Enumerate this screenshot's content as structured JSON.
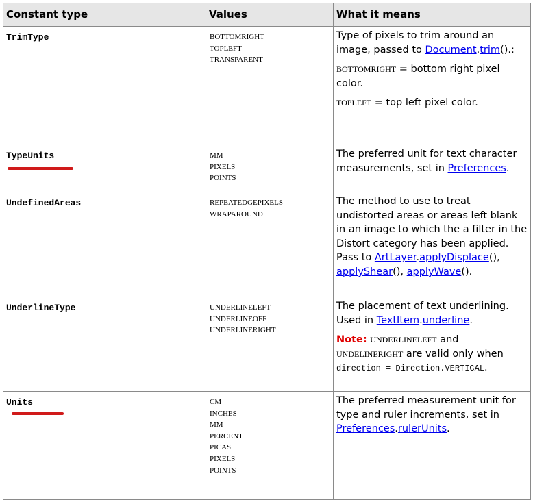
{
  "headers": [
    "Constant type",
    "Values",
    "What it means"
  ],
  "rows": [
    {
      "name": "TrimType",
      "values": [
        "BOTTOMRIGHT",
        "TOPLEFT",
        "TRANSPARENT"
      ],
      "desc": {
        "p1_text": "Type of pixels to trim around an image, passed to ",
        "p1_link1": "Document",
        "p1_dot": ".",
        "p1_link2": "trim",
        "p1_end": "().:",
        "p2_code": "BOTTOMRIGHT",
        "p2_text": " = bottom right pixel color.",
        "p3_code": "TOPLEFT",
        "p3_text": " = top left pixel color."
      }
    },
    {
      "name": "TypeUnits",
      "values": [
        "MM",
        "PIXELS",
        "POINTS"
      ],
      "desc": {
        "text": "The preferred unit for text character measurements, set in ",
        "link": "Preferences",
        "end": "."
      }
    },
    {
      "name": "UndefinedAreas",
      "values": [
        "REPEATEDGEPIXELS",
        "WRAPAROUND"
      ],
      "desc": {
        "text": "The method to use to treat undistorted areas or areas left blank in an image to which the a filter in the Distort category has been applied. Pass to ",
        "link1": "ArtLayer",
        "dot": ".",
        "link2": "applyDisplace",
        "sep1": "(), ",
        "link3": "applyShear",
        "sep2": "(), ",
        "link4": "applyWave",
        "end": "()."
      }
    },
    {
      "name": "UnderlineType",
      "values": [
        "UNDERLINELEFT",
        "UNDERLINEOFF",
        "UNDERLINERIGHT"
      ],
      "desc": {
        "text": "The placement of text underlining. Used in ",
        "link1": "TextItem",
        "dot": ".",
        "link2": "underline",
        "end": ".",
        "note_label": "Note:",
        "note_code1": "UNDERLINELEFT",
        "note_and": " and ",
        "note_code2": "UNDELINERIGHT",
        "note_text": " are valid only when ",
        "note_code3": "direction = Direction.VERTICAL",
        "note_end": "."
      }
    },
    {
      "name": "Units",
      "values": [
        "CM",
        "INCHES",
        "MM",
        "PERCENT",
        "PICAS",
        "PIXELS",
        "POINTS"
      ],
      "desc": {
        "text": "The preferred measurement unit for type and ruler increments, set in ",
        "link1": "Preferences",
        "dot": ".",
        "link2": "rulerUnits",
        "end": "."
      }
    }
  ],
  "colors": {
    "header_bg": "#e6e6e6",
    "link": "#0000ee",
    "note": "#e00000",
    "annotation_underline": "#d01a1a"
  }
}
